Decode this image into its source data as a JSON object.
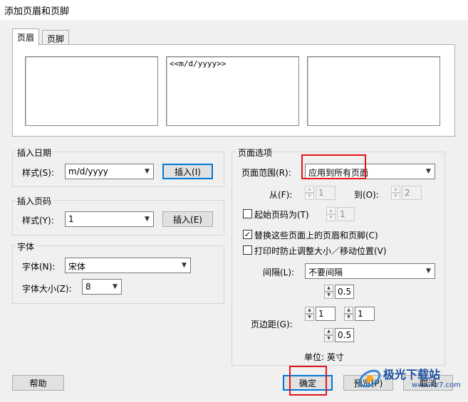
{
  "window": {
    "title": "添加页眉和页脚"
  },
  "tabs": [
    {
      "label": "页眉",
      "active": true
    },
    {
      "label": "页脚",
      "active": false
    }
  ],
  "header_boxes": {
    "left": "",
    "center": "<<m/d/yyyy>>",
    "right": ""
  },
  "insert_date": {
    "group_label": "插入日期",
    "style_label": "样式(S):",
    "style_value": "m/d/yyyy",
    "insert_button": "插入(I)"
  },
  "insert_page": {
    "group_label": "插入页码",
    "style_label": "样式(Y):",
    "style_value": "1",
    "insert_button": "插入(E)"
  },
  "font": {
    "group_label": "字体",
    "font_label": "字体(N):",
    "font_value": "宋体",
    "size_label": "字体大小(Z):",
    "size_value": "8"
  },
  "page_options": {
    "group_label": "页面选项",
    "range_label": "页面范围(R):",
    "range_value": "应用到所有页面",
    "from_label": "从(F):",
    "from_value": "1",
    "to_label": "到(O):",
    "to_value": "2",
    "start_page_label": "起始页码为(T)",
    "start_page_value": "1",
    "start_page_checked": false,
    "replace_label": "替换这些页面上的页眉和页脚(C)",
    "replace_checked": true,
    "prevent_resize_label": "打印时防止调整大小／移动位置(V)",
    "prevent_resize_checked": false,
    "spacing_label": "间隔(L):",
    "spacing_value": "不要间隔",
    "spacing_amount": "0.5",
    "margin_label": "页边距(G):",
    "margin_left": "1",
    "margin_right": "1",
    "margin_bottom": "0.5",
    "unit_label": "单位: 英寸"
  },
  "buttons": {
    "help": "帮助",
    "ok": "确定",
    "preview": "预览(P)",
    "cancel": "取消"
  },
  "watermark": {
    "brand": "极光下载站",
    "url": "www.xz7.com"
  },
  "colors": {
    "highlight_red": "#e5141b",
    "focus_blue": "#0078d7"
  }
}
